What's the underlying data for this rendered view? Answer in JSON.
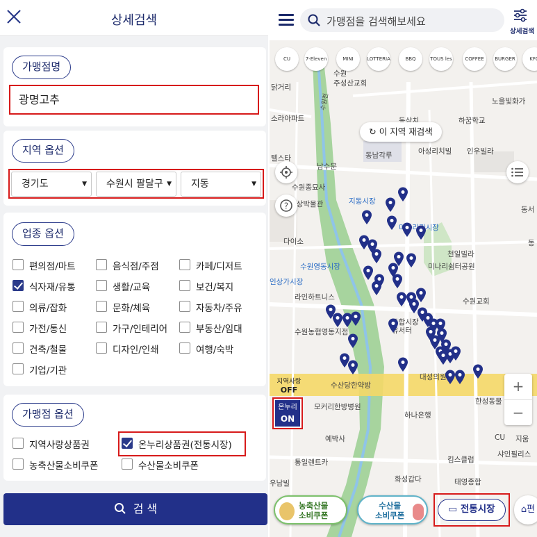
{
  "left": {
    "title": "상세검색",
    "store_name": {
      "label": "가맹점명",
      "value": "광명고추"
    },
    "region": {
      "label": "지역 옵션",
      "selects": [
        "경기도",
        "수원시 팔달구",
        "지동"
      ]
    },
    "business": {
      "label": "업종 옵션",
      "items": [
        {
          "label": "편의점/마트",
          "checked": false
        },
        {
          "label": "음식점/주점",
          "checked": false
        },
        {
          "label": "카페/디저트",
          "checked": false
        },
        {
          "label": "식자재/유통",
          "checked": true
        },
        {
          "label": "생활/교육",
          "checked": false
        },
        {
          "label": "보건/복지",
          "checked": false
        },
        {
          "label": "의류/잡화",
          "checked": false
        },
        {
          "label": "문화/체육",
          "checked": false
        },
        {
          "label": "자동차/주유",
          "checked": false
        },
        {
          "label": "가전/통신",
          "checked": false
        },
        {
          "label": "가구/인테리어",
          "checked": false
        },
        {
          "label": "부동산/임대",
          "checked": false
        },
        {
          "label": "건축/철물",
          "checked": false
        },
        {
          "label": "디자인/인쇄",
          "checked": false
        },
        {
          "label": "여행/숙박",
          "checked": false
        },
        {
          "label": "기업/기관",
          "checked": false
        }
      ]
    },
    "store_option": {
      "label": "가맹점 옵션",
      "items": [
        {
          "label": "지역사랑상품권",
          "checked": false
        },
        {
          "label": "온누리상품권(전통시장)",
          "checked": true
        },
        {
          "label": "농축산물소비쿠폰",
          "checked": false
        },
        {
          "label": "수산물소비쿠폰",
          "checked": false
        }
      ]
    },
    "search_label": "검 색"
  },
  "right": {
    "search_placeholder": "가맹점을 검색해보세요",
    "filter_label": "상세검색",
    "brands": [
      "CU",
      "7-Eleven",
      "MINI STOP",
      "LOTTERIA",
      "BBQ",
      "TOUS les JOURS",
      "COFFEE BAY",
      "BURGER",
      "KFC"
    ],
    "rescan_label": "이 지역 재검색",
    "local_toggle": {
      "label": "지역사랑",
      "value": "OFF"
    },
    "onnuri_toggle": {
      "label": "온누리",
      "value": "ON"
    },
    "bottom": {
      "agri_line1": "농축산물",
      "agri_line2": "소비쿠폰",
      "sea_line1": "수산물",
      "sea_line2": "소비쿠폰",
      "traditional": "전통시장",
      "more": "편"
    },
    "map_labels": {
      "l1": "수원",
      "l2": "주성산교회",
      "l3": "닭거리",
      "l4": "수원천",
      "l5": "노을빛화가",
      "l6": "소라아파트",
      "l7": "동삼치",
      "l8": "하꿈학교",
      "l9": "텔스타",
      "l10": "아성리치빌",
      "l11": "인우빌라",
      "l12": "동남각루",
      "l13": "남수문",
      "l14": "수원종묘사",
      "l15": "2상박물관",
      "l16": "지동시장",
      "l17": "미나리광시장",
      "l18": "다이소",
      "l19": "수원영동시장",
      "l20": "천일빌라",
      "l21": "미나리쉼터공원",
      "l22": "인상가시장",
      "l23": "라인하트니스",
      "l24": "수원교회",
      "l25": "수원농협영동지점",
      "l26": "동합시장",
      "l27": "유서터",
      "l28": "수산당한약방",
      "l29": "대성의원",
      "l30": "한성동물",
      "l31": "모커리한방병원",
      "l32": "하나은행",
      "l33": "예박사",
      "l34": "CU",
      "l35": "지움",
      "l36": "킴스클럽",
      "l37": "샤인필리스",
      "l38": "통일렌트카",
      "l39": "화성갑다",
      "l40": "태영종합",
      "l41": "우남빌",
      "l42": "동서",
      "l43": "동"
    },
    "zoom_in": "+",
    "zoom_out": "−"
  }
}
